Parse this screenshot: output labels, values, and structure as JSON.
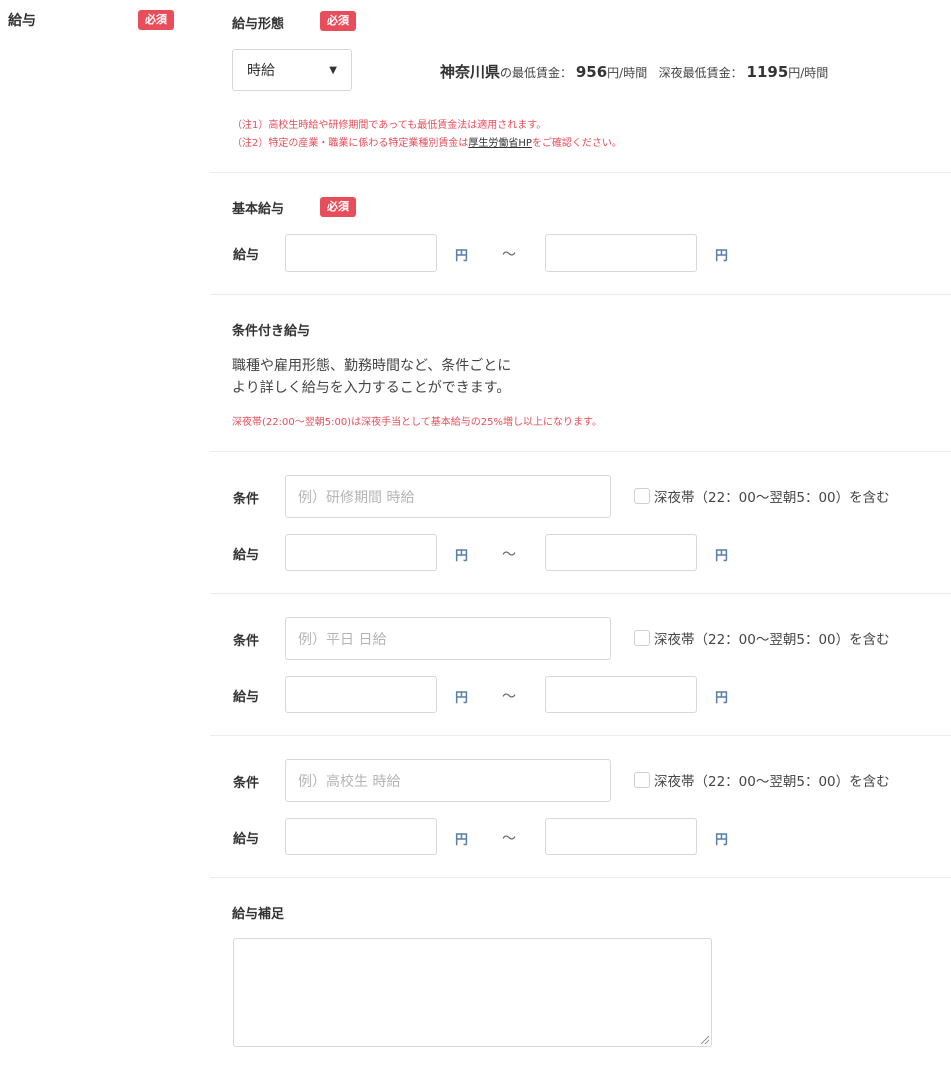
{
  "field": {
    "label": "給与",
    "required_badge": "必須"
  },
  "pay_type": {
    "title": "給与形態",
    "required_badge": "必須",
    "selected": "時給",
    "min_wage": {
      "prefecture": "神奈川県",
      "prefecture_suffix": "の最低賃金：",
      "value": "956",
      "unit": "円/時間",
      "night_label": "深夜最低賃金：",
      "night_value": "1195",
      "night_unit": "円/時間"
    },
    "notes": {
      "note1": "（注1）高校生時給や研修期間であっても最低賃金法は適用されます。",
      "note2_prefix": "（注2）特定の産業・職業に係わる特定業種別賃金は",
      "note2_link": "厚生労働省HP",
      "note2_suffix": "をご確認ください。"
    }
  },
  "basic_pay": {
    "title": "基本給与",
    "required_badge": "必須",
    "pay_label": "給与",
    "unit": "円",
    "tilde": "～"
  },
  "conditional_pay": {
    "title": "条件付き給与",
    "desc_line1": "職種や雇用形態、勤務時間など、条件ごとに",
    "desc_line2": "より詳しく給与を入力することができます。",
    "night_note": "深夜帯(22:00～翌朝5:00)は深夜手当として基本給与の25%増し以上になります。",
    "rows": [
      {
        "condition_label": "条件",
        "placeholder": "例）研修期間 時給",
        "night_checkbox": "深夜帯（22：00～翌朝5：00）を含む",
        "pay_label": "給与",
        "unit": "円",
        "tilde": "～"
      },
      {
        "condition_label": "条件",
        "placeholder": "例）平日 日給",
        "night_checkbox": "深夜帯（22：00～翌朝5：00）を含む",
        "pay_label": "給与",
        "unit": "円",
        "tilde": "～"
      },
      {
        "condition_label": "条件",
        "placeholder": "例）高校生 時給",
        "night_checkbox": "深夜帯（22：00～翌朝5：00）を含む",
        "pay_label": "給与",
        "unit": "円",
        "tilde": "～"
      }
    ]
  },
  "pay_supplement": {
    "title": "給与補足"
  },
  "colors": {
    "required": "#e84d5b",
    "note_red": "#e84d5b",
    "unit_blue": "#5b7fa6"
  }
}
